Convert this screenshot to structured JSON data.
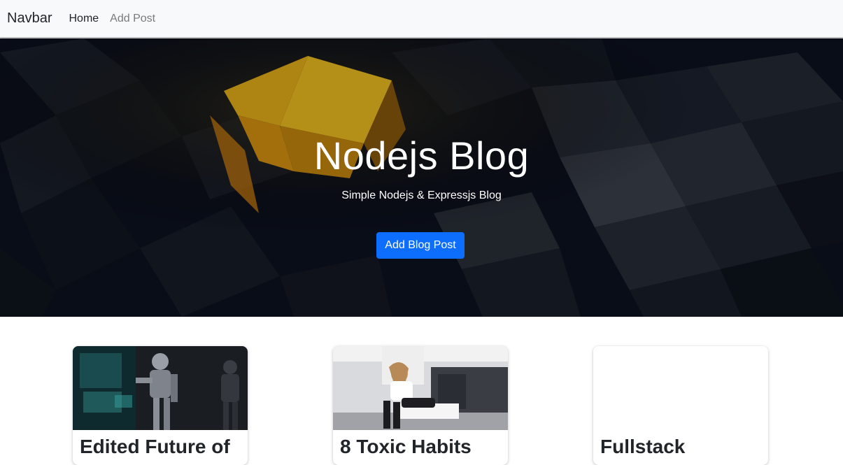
{
  "navbar": {
    "brand": "Navbar",
    "links": [
      {
        "label": "Home",
        "state": "active"
      },
      {
        "label": "Add Post",
        "state": "inactive"
      }
    ]
  },
  "hero": {
    "title": "Nodejs Blog",
    "subtitle": "Simple Nodejs & Expressjs Blog",
    "button_label": "Add Blog Post",
    "button_color": "#0d6efd",
    "background_image": "dark-3d-cubes-with-glowing-yellow-cube"
  },
  "posts": [
    {
      "title": "Edited Future of",
      "image": "robot-touching-holographic-screen"
    },
    {
      "title": "8 Toxic Habits",
      "image": "woman-sitting-on-kitchen-counter"
    },
    {
      "title": "Fullstack",
      "image": "blank"
    }
  ]
}
